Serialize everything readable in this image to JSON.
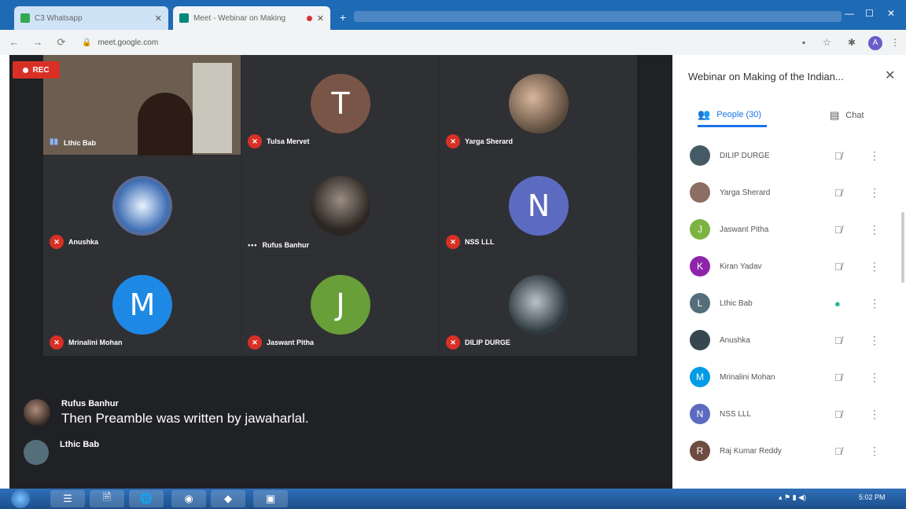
{
  "browser": {
    "tabs": [
      {
        "title": "C3 Whatsapp",
        "favicon_color": "#33a852"
      },
      {
        "title": "Meet - Webinar on Making",
        "favicon_color": "#00897b"
      }
    ],
    "new_tab_symbol": "+",
    "window_controls": [
      "—",
      "☐",
      "✕"
    ],
    "url": "meet.google.com",
    "nav_icons": [
      "←",
      "→",
      "⟳"
    ],
    "profile_initial": "A"
  },
  "meeting": {
    "rec_label": "REC",
    "tiles": [
      {
        "name": "Lthic Bab",
        "kind": "video",
        "mic": "on"
      },
      {
        "name": "Tulsa Mervet",
        "kind": "letter",
        "letter": "T",
        "color": "#795548",
        "mic": "off"
      },
      {
        "name": "Yarga Sherard",
        "kind": "photo",
        "mic": "off"
      },
      {
        "name": "Anushka",
        "kind": "photo",
        "mic": "off"
      },
      {
        "name": "Rufus Banhur",
        "kind": "photo",
        "mic": "more"
      },
      {
        "name": "NSS LLL",
        "kind": "letter",
        "letter": "N",
        "color": "#5c6bc0",
        "mic": "off"
      },
      {
        "name": "Mrinalini Mohan",
        "kind": "letter",
        "letter": "M",
        "color": "#1e88e5",
        "mic": "off"
      },
      {
        "name": "Jaswant Pitha",
        "kind": "letter",
        "letter": "J",
        "color": "#689f38",
        "mic": "off"
      },
      {
        "name": "DILIP DURGE",
        "kind": "photo",
        "mic": "off"
      }
    ],
    "captions": [
      {
        "name": "Rufus Banhur",
        "text": "Then Preamble was written by jawaharlal."
      },
      {
        "name": "Lthic Bab",
        "text": ""
      }
    ]
  },
  "panel": {
    "title": "Webinar on Making of the Indian...",
    "close_symbol": "✕",
    "tabs": [
      {
        "label": "People (30)",
        "icon": "people-icon",
        "active": true
      },
      {
        "label": "Chat",
        "icon": "chat-icon",
        "active": false
      }
    ],
    "participants": [
      {
        "name": "DILIP DURGE",
        "initial": "",
        "color": "#455a64",
        "mic": "off"
      },
      {
        "name": "Yarga Sherard",
        "initial": "",
        "color": "#8d6e63",
        "mic": "off"
      },
      {
        "name": "Jaswant Pitha",
        "initial": "J",
        "color": "#7cb342",
        "mic": "off"
      },
      {
        "name": "Kiran Yadav",
        "initial": "K",
        "color": "#8e24aa",
        "mic": "off"
      },
      {
        "name": "Lthic Bab",
        "initial": "L",
        "color": "#546e7a",
        "mic": "on"
      },
      {
        "name": "Anushka",
        "initial": "",
        "color": "#37474f",
        "mic": "off"
      },
      {
        "name": "Mrinalini Mohan",
        "initial": "M",
        "color": "#039be5",
        "mic": "off"
      },
      {
        "name": "NSS LLL",
        "initial": "N",
        "color": "#5c6bc0",
        "mic": "off"
      },
      {
        "name": "Raj Kumar Reddy",
        "initial": "R",
        "color": "#6d4c41",
        "mic": "off"
      }
    ]
  },
  "taskbar": {
    "items": [
      "☰",
      "🗎",
      "🌐",
      "◉",
      "◆",
      "▣"
    ],
    "clock": "5:02 PM"
  }
}
